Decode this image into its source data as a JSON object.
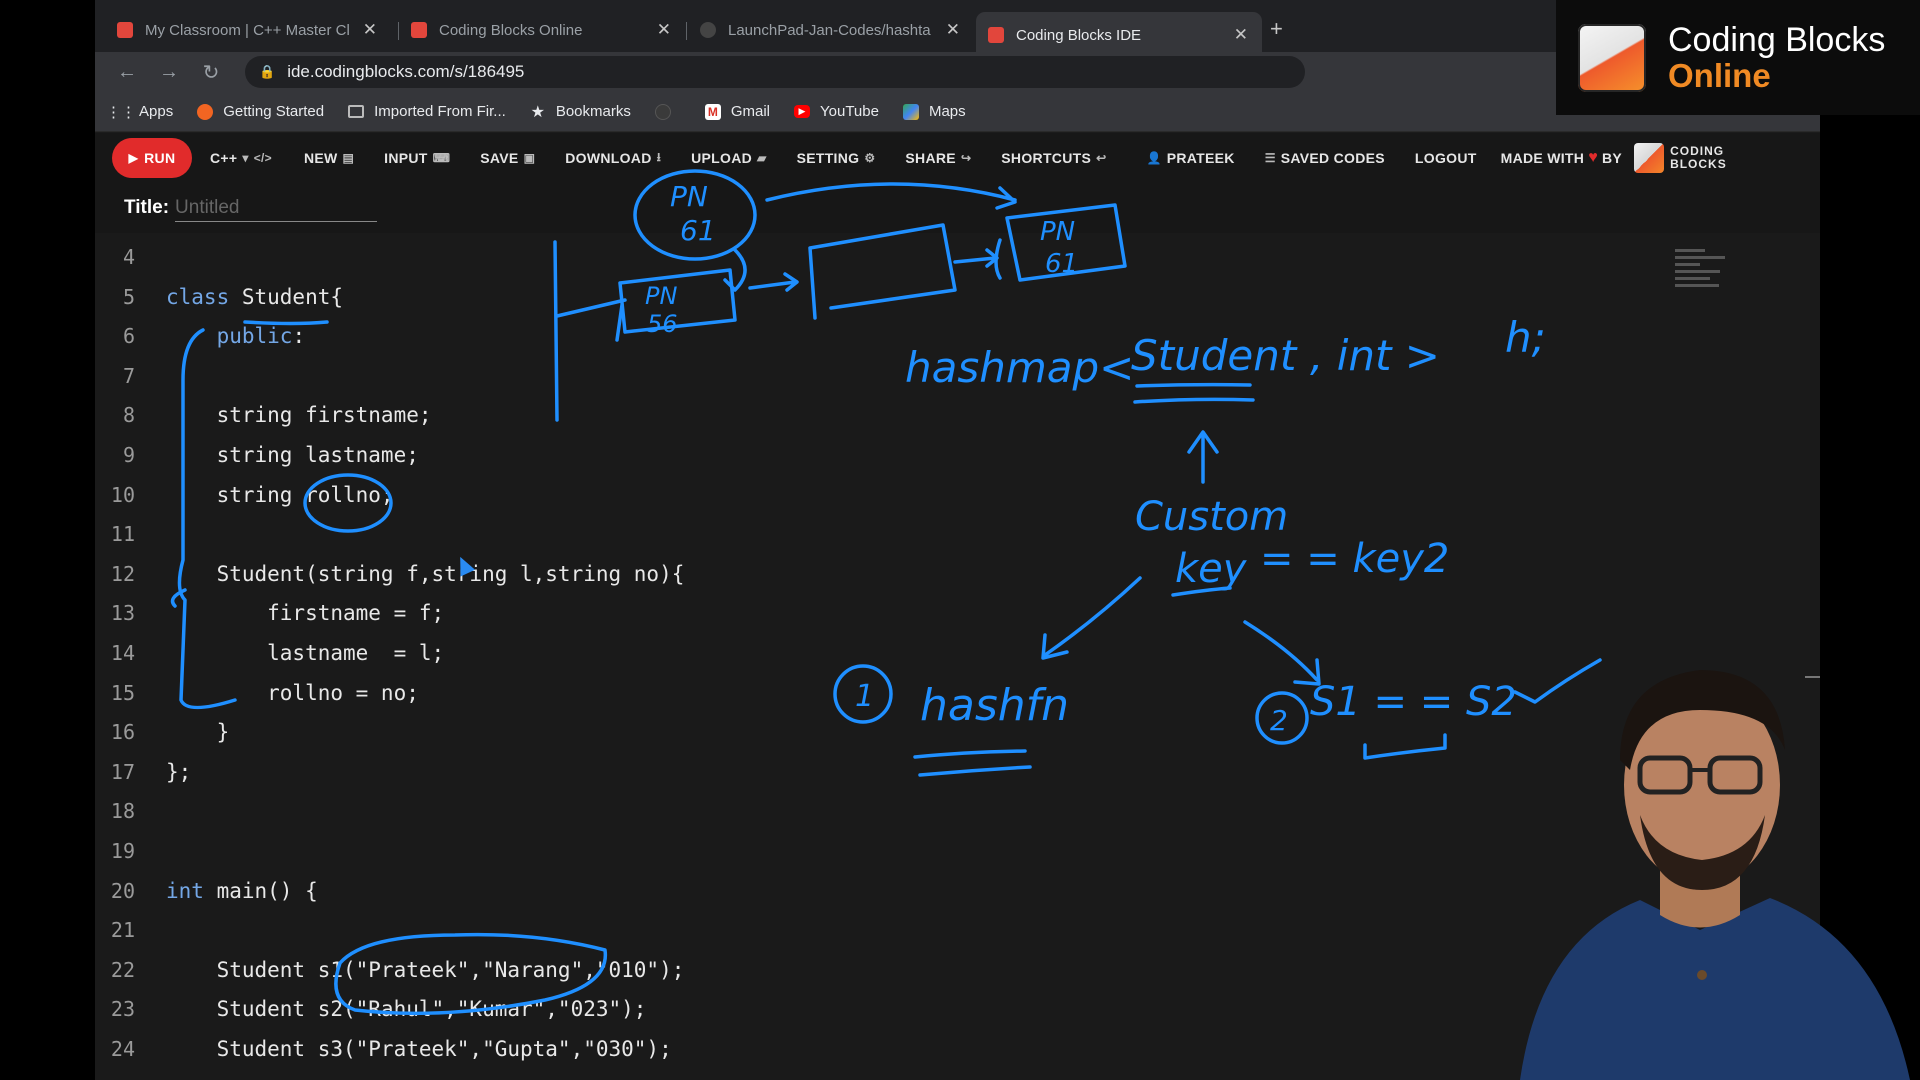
{
  "tabs": [
    {
      "title": "My Classroom | C++ Master Cl",
      "active": false
    },
    {
      "title": "Coding Blocks Online",
      "active": false
    },
    {
      "title": "LaunchPad-Jan-Codes/hashta",
      "active": false
    },
    {
      "title": "Coding Blocks IDE",
      "active": true
    }
  ],
  "address": {
    "url": "ide.codingblocks.com/s/186495"
  },
  "bookmarks": [
    {
      "label": "Apps",
      "icon": "apps-grid-icon"
    },
    {
      "label": "Getting Started",
      "icon": "firefox-icon"
    },
    {
      "label": "Imported From Fir...",
      "icon": "folder-icon"
    },
    {
      "label": "Bookmarks",
      "icon": "star-icon"
    },
    {
      "label": "",
      "icon": "github-icon"
    },
    {
      "label": "Gmail",
      "icon": "gmail-icon"
    },
    {
      "label": "YouTube",
      "icon": "youtube-icon"
    },
    {
      "label": "Maps",
      "icon": "maps-icon"
    }
  ],
  "ide": {
    "run": "RUN",
    "language": "C++",
    "new": "NEW",
    "input": "INPUT",
    "save": "SAVE",
    "download": "DOWNLOAD",
    "upload": "UPLOAD",
    "setting": "SETTING",
    "share": "SHARE",
    "shortcuts": "SHORTCUTS",
    "user": "PRATEEK",
    "saved_codes": "SAVED CODES",
    "logout": "LOGOUT",
    "made_with": "MADE WITH",
    "by": "BY",
    "logo_line1": "CODING",
    "logo_line2": "BLOCKS",
    "title_label": "Title:",
    "title_placeholder": "Untitled"
  },
  "code": {
    "lines": [
      {
        "n": "4",
        "text": ""
      },
      {
        "n": "5",
        "text": "class Student{"
      },
      {
        "n": "6",
        "text": "    public:"
      },
      {
        "n": "7",
        "text": ""
      },
      {
        "n": "8",
        "text": "    string firstname;"
      },
      {
        "n": "9",
        "text": "    string lastname;"
      },
      {
        "n": "10",
        "text": "    string rollno;"
      },
      {
        "n": "11",
        "text": ""
      },
      {
        "n": "12",
        "text": "    Student(string f,string l,string no){"
      },
      {
        "n": "13",
        "text": "        firstname = f;"
      },
      {
        "n": "14",
        "text": "        lastname  = l;"
      },
      {
        "n": "15",
        "text": "        rollno = no;"
      },
      {
        "n": "16",
        "text": "    }"
      },
      {
        "n": "17",
        "text": "};"
      },
      {
        "n": "18",
        "text": ""
      },
      {
        "n": "19",
        "text": ""
      },
      {
        "n": "20",
        "text": "int main() {"
      },
      {
        "n": "21",
        "text": ""
      },
      {
        "n": "22",
        "text": "    Student s1(\"Prateek\",\"Narang\",\"010\");"
      },
      {
        "n": "23",
        "text": "    Student s2(\"Rahul\",\"Kumar\",\"023\");"
      },
      {
        "n": "24",
        "text": "    Student s3(\"Prateek\",\"Gupta\",\"030\");"
      }
    ]
  },
  "annotations": {
    "color": "#1f8fff",
    "pn61_top": [
      "PN",
      "61"
    ],
    "pn56": [
      "PN",
      "56"
    ],
    "pn61_right": [
      "PN",
      "61"
    ],
    "hashmap": "hashmap<",
    "student": "Student",
    "int_part": ", int >",
    "h_var": "h;",
    "custom": "Custom",
    "key": "key",
    "equals_key2": "= =  key2",
    "num1": "1",
    "hashfn": "hashfn",
    "num2": "2",
    "s1_eq_s2": "S1 = = S2"
  },
  "brand": {
    "line1": "Coding Blocks",
    "line2": "Online"
  },
  "colors": {
    "run": "#e12b2b",
    "keyword": "#74a7e6",
    "brand_orange": "#f08a24",
    "ink": "#1f8fff"
  }
}
